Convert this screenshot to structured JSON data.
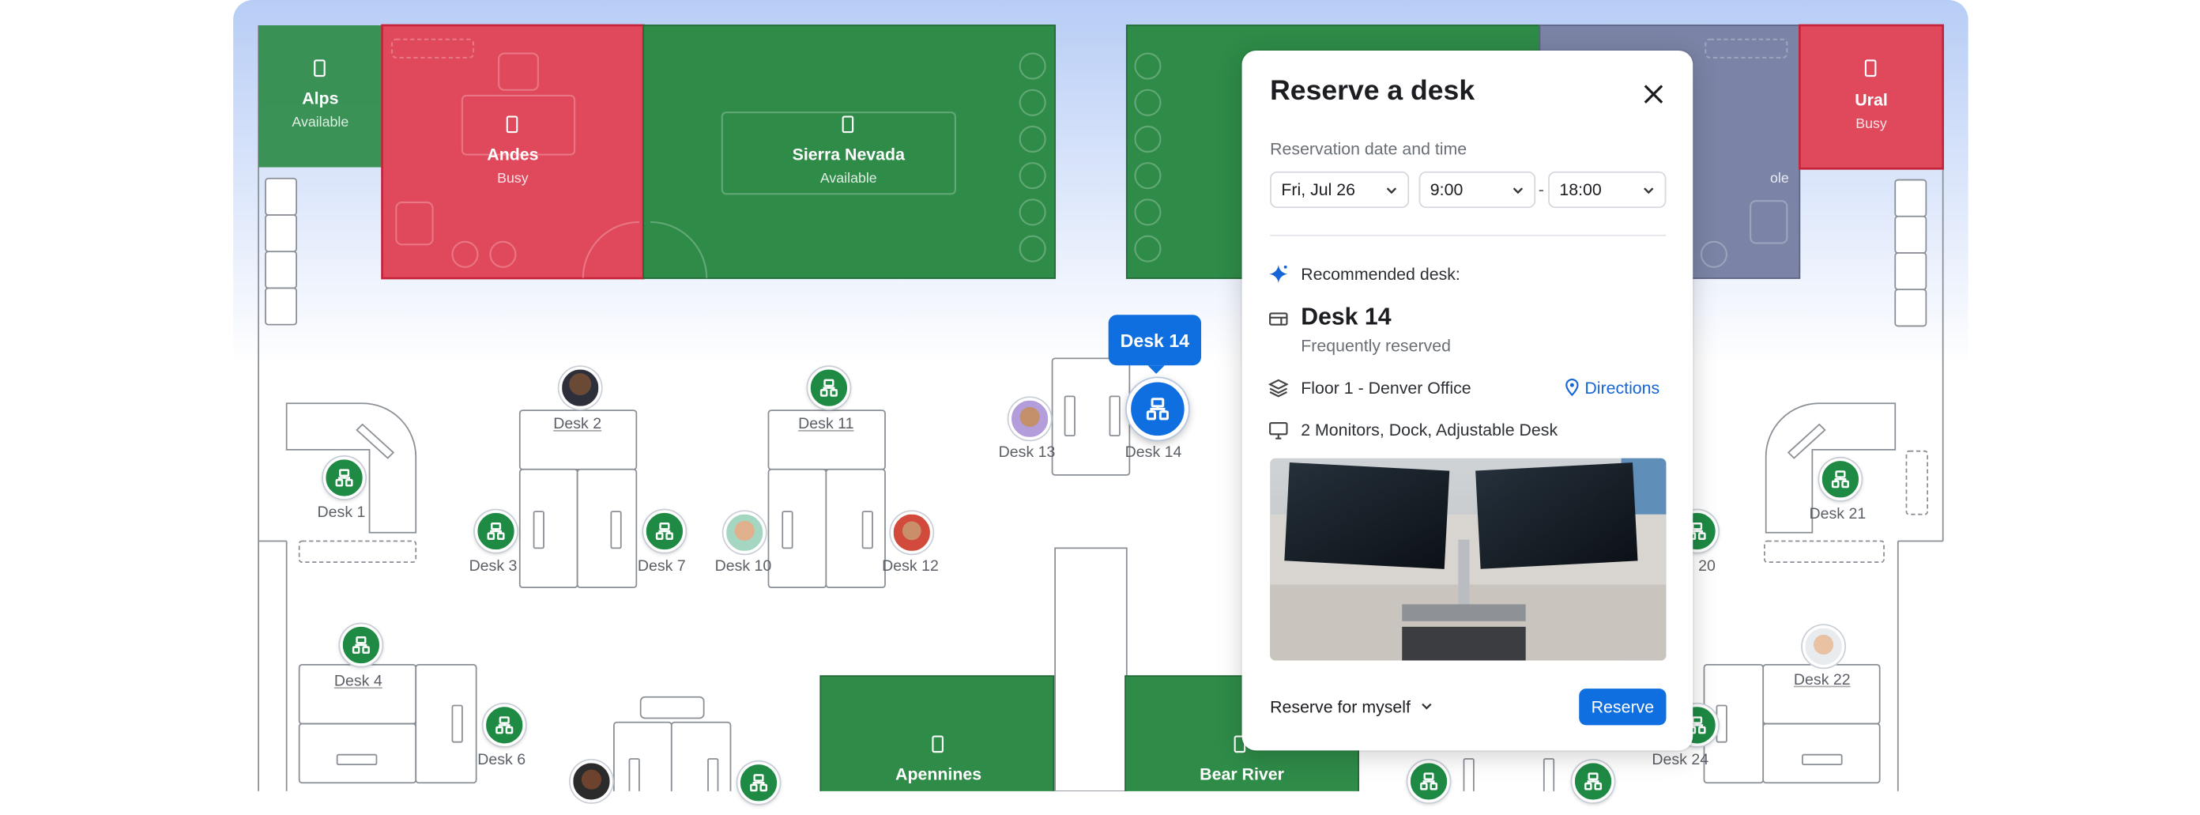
{
  "colors": {
    "available": "#2e8b48",
    "busy": "#e0485c",
    "selected": "#0f6fe0",
    "neutral_room": "#7b84a6"
  },
  "rooms": [
    {
      "name": "Alps",
      "status": "Available"
    },
    {
      "name": "Andes",
      "status": "Busy"
    },
    {
      "name": "Sierra Nevada",
      "status": "Available"
    },
    {
      "name": "Ural",
      "status": "Busy"
    },
    {
      "name": "Apennines",
      "status": ""
    },
    {
      "name": "Bear River",
      "status": ""
    }
  ],
  "partial_status": "ole",
  "desks": {
    "d1": "Desk 1",
    "d2": "Desk 2",
    "d3": "Desk 3",
    "d4": "Desk 4",
    "d6": "Desk 6",
    "d7": "Desk 7",
    "d10": "Desk 10",
    "d11": "Desk 11",
    "d12": "Desk 12",
    "d13": "Desk 13",
    "d14": "Desk 14",
    "d20": "20",
    "d21": "Desk 21",
    "d22": "Desk 22",
    "d24": "Desk 24"
  },
  "tooltip": "Desk 14",
  "panel": {
    "title": "Reserve a desk",
    "reservation_label": "Reservation date and time",
    "date": "Fri, Jul 26",
    "start_time": "9:00",
    "separator": "-",
    "end_time": "18:00",
    "recommended_label": "Recommended desk:",
    "desk_name": "Desk 14",
    "desk_note": "Frequently reserved",
    "location": "Floor 1 - Denver Office",
    "directions": "Directions",
    "amenities": "2 Monitors, Dock, Adjustable Desk",
    "reserve_for": "Reserve for myself",
    "reserve_button": "Reserve"
  }
}
